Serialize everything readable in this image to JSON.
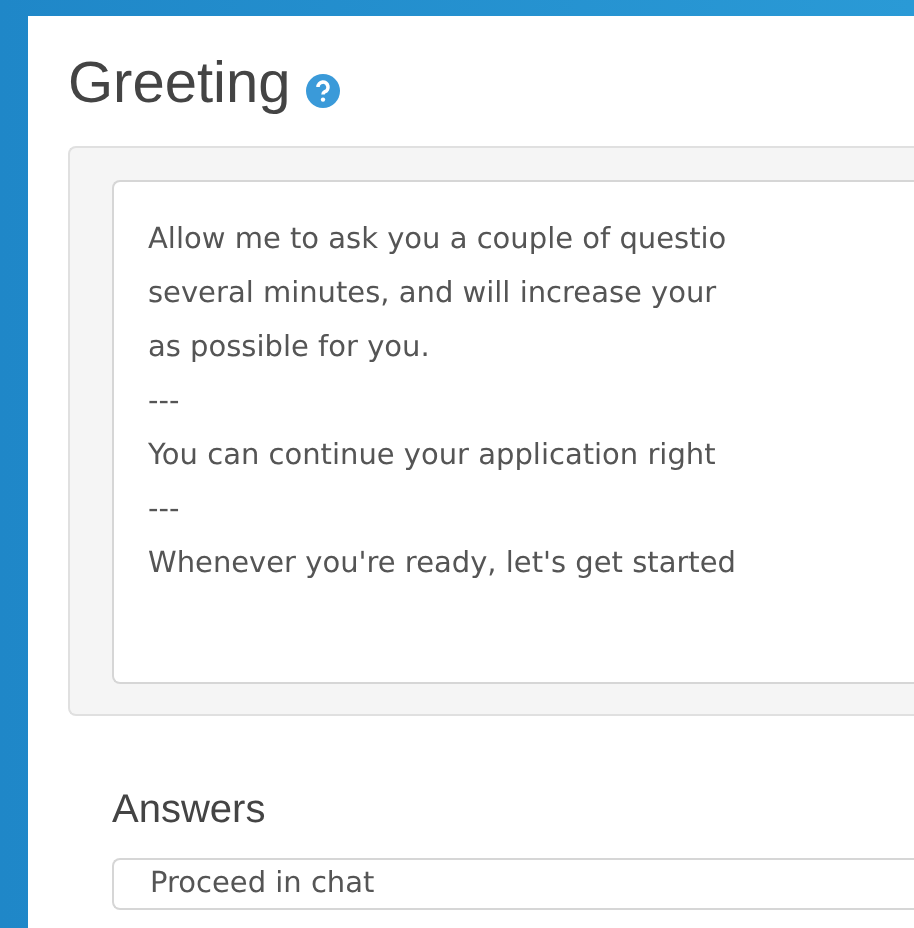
{
  "greeting": {
    "title": "Greeting",
    "message_lines": [
      "Allow me to ask you a couple of questio",
      "several minutes, and will increase your",
      "as possible for you.",
      "---",
      "You can continue your application right",
      "---",
      "Whenever you're ready, let's get started"
    ]
  },
  "answers": {
    "label": "Answers",
    "items": [
      "Proceed in chat"
    ]
  }
}
